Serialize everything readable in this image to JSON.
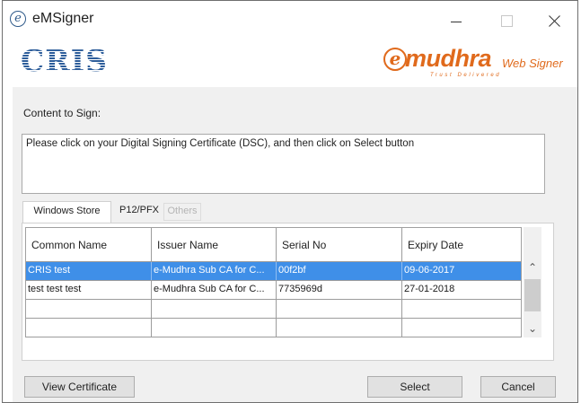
{
  "window": {
    "title": "eMSigner",
    "app_icon": "e-icon"
  },
  "branding": {
    "left_logo": "CRIS",
    "right_logo_e": "e",
    "right_logo_name": "mudhra",
    "right_logo_tagline": "Trust Delivered",
    "right_logo_product": "Web Signer",
    "accent_color": "#e06a1c",
    "cris_color": "#2d5d9a"
  },
  "content": {
    "label": "Content to Sign:",
    "message": "Please click on your Digital Signing Certificate (DSC), and then click on Select button"
  },
  "tabs": [
    {
      "label": "Windows Store",
      "active": true,
      "enabled": true
    },
    {
      "label": "P12/PFX",
      "active": false,
      "enabled": true
    },
    {
      "label": "Others",
      "active": false,
      "enabled": false
    }
  ],
  "table": {
    "columns": [
      "Common Name",
      "Issuer Name",
      "Serial No",
      "Expiry Date"
    ],
    "rows": [
      {
        "common_name": "CRIS test",
        "issuer": "e-Mudhra Sub CA for C...",
        "serial": "00f2bf",
        "expiry": "09-06-2017",
        "selected": true
      },
      {
        "common_name": "test test test",
        "issuer": "e-Mudhra Sub CA for C...",
        "serial": "7735969d",
        "expiry": "27-01-2018",
        "selected": false
      }
    ],
    "selected_color": "#3f8fe8"
  },
  "buttons": {
    "view_certificate": "View Certificate",
    "select": "Select",
    "cancel": "Cancel"
  }
}
